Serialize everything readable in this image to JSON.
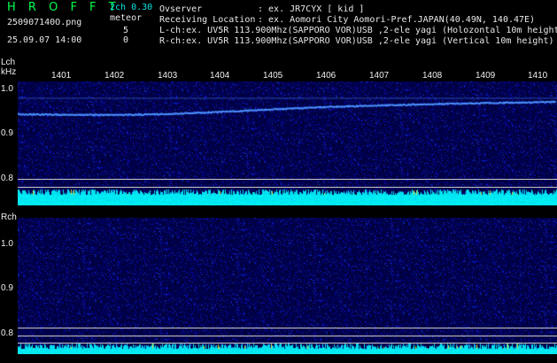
{
  "header": {
    "brand": "H R O F F T",
    "filename": "250907140O.png",
    "datetime": "25.09.07 14:00",
    "mode": "2ch 0.30",
    "meteor_label": "meteor",
    "meteor_lch": "5",
    "meteor_rch": "0",
    "observer_label": "Ovserver",
    "observer_value": ": ex. JR7CYX [ kid ]",
    "location_label": "Receiving Location",
    "location_value": ": ex. Aomori City Aomori-Pref.JAPAN(40.49N, 140.47E)",
    "lch_line": "L-ch:ex. UV5R 113.900Mhz(SAPPORO VOR)USB ,2-ele yagi (Holozontal 10m height",
    "rch_line": "R-ch:ex. UV5R 113.900Mhz(SAPPORO VOR)USB ,2-ele yagi (Vertical 10m height)"
  },
  "lch": {
    "label": "Lch",
    "unit": "kHz",
    "y_ticks": [
      "1.0",
      "0.9",
      "0.8"
    ],
    "time_ticks": [
      "1401",
      "1402",
      "1403",
      "1404",
      "1405",
      "1406",
      "1407",
      "1408",
      "1409",
      "1410"
    ]
  },
  "rch": {
    "label": "Rch",
    "y_ticks": [
      "1.0",
      "0.9",
      "0.8"
    ]
  },
  "colors": {
    "background": "#000000",
    "spectrum_bg": "#00005a",
    "level_bar": "#00e6f0",
    "carrier": "#3c8cff",
    "grid_line": "#c8c8c8"
  }
}
